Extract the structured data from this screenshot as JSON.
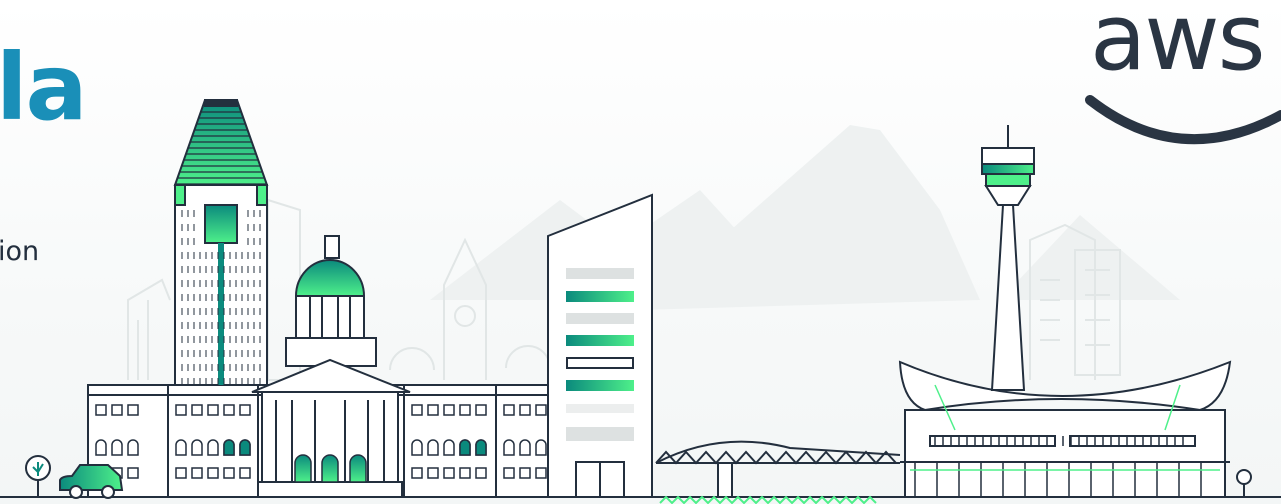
{
  "hero": {
    "title_fragment": "la",
    "subtitle_fragment": "ion"
  },
  "logo": {
    "text": "aws",
    "icon": "amazon-smile-icon"
  },
  "illustration": {
    "icons": [
      "tree-icon",
      "car-icon",
      "lamp-post-icon"
    ],
    "colors": {
      "accent_dark": "#0b8a7d",
      "accent_light": "#4ef08a",
      "line": "#232f3e",
      "title_blue": "#1a8fb8",
      "ghost": "#e8eded"
    }
  }
}
